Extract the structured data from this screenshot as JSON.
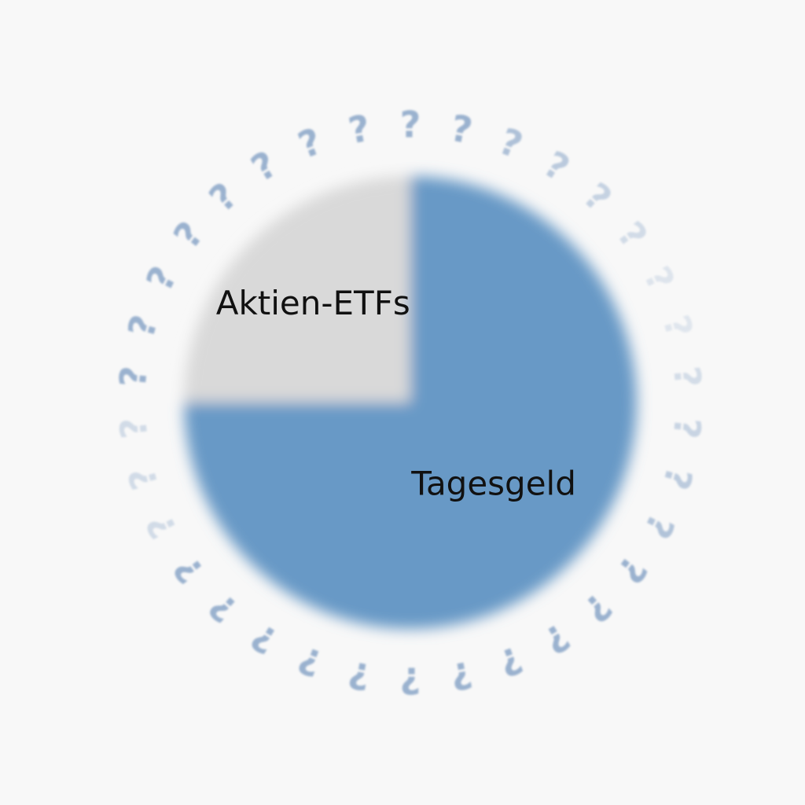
{
  "chart_data": {
    "type": "pie",
    "slices": [
      {
        "label": "Tagesgeld",
        "value": 75,
        "color": "#6899c6"
      },
      {
        "label": "Aktien-ETFs",
        "value": 25,
        "color": "#d9d9d9"
      }
    ],
    "start_angle_deg": 0,
    "legend": "none"
  },
  "decoration": {
    "ring_glyph": "?",
    "ring_color": "#8aa6c8"
  }
}
